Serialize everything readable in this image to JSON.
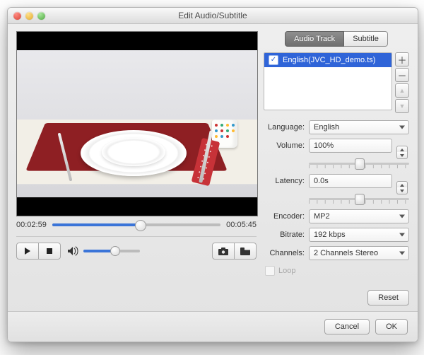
{
  "window": {
    "title": "Edit Audio/Subtitle"
  },
  "tabs": {
    "audio": "Audio Track",
    "subtitle": "Subtitle"
  },
  "tracklist": {
    "items": [
      {
        "checked": true,
        "label": "English(JVC_HD_demo.ts)"
      }
    ]
  },
  "labels": {
    "language": "Language:",
    "volume": "Volume:",
    "latency": "Latency:",
    "encoder": "Encoder:",
    "bitrate": "Bitrate:",
    "channels": "Channels:",
    "loop": "Loop"
  },
  "values": {
    "language": "English",
    "volume": "100%",
    "latency": "0.0s",
    "encoder": "MP2",
    "bitrate": "192 kbps",
    "channels": "2 Channels Stereo"
  },
  "sliders": {
    "volume_pct": 50,
    "latency_pct": 50,
    "playback_pct": 52,
    "system_volume_pct": 55
  },
  "player": {
    "current": "00:02:59",
    "total": "00:05:45"
  },
  "buttons": {
    "reset": "Reset",
    "cancel": "Cancel",
    "ok": "OK"
  },
  "icons": {
    "add": "＋",
    "remove": "－",
    "up": "▲",
    "down": "▼",
    "check": "✓"
  }
}
